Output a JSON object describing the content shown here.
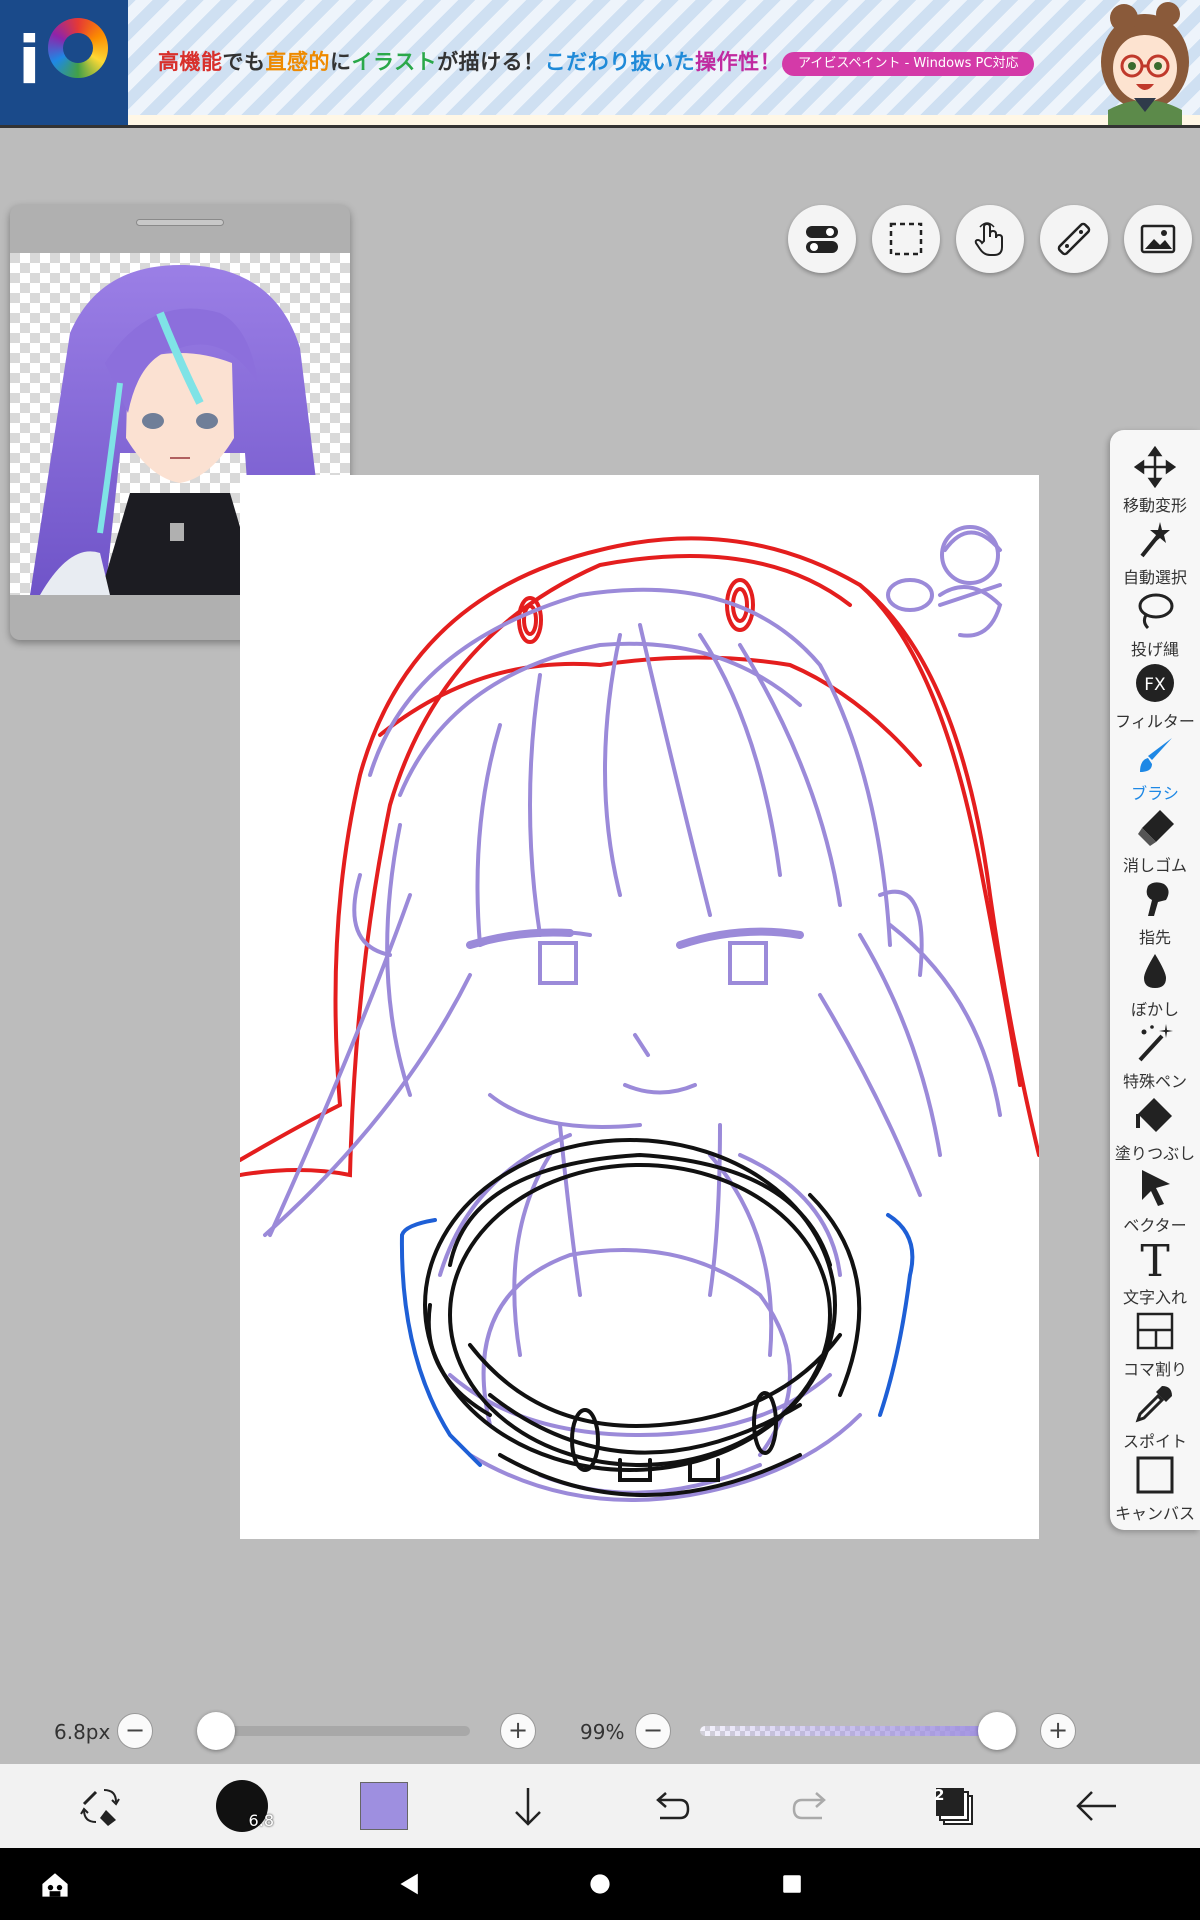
{
  "banner": {
    "headline_segments": [
      {
        "text": "高機能",
        "color": "#d8302c"
      },
      {
        "text": "でも",
        "color": "#333333"
      },
      {
        "text": "直感的",
        "color": "#ee8a00"
      },
      {
        "text": "に",
        "color": "#333333"
      },
      {
        "text": "イラスト",
        "color": "#2aa84a"
      },
      {
        "text": "が描ける！",
        "color": "#333333"
      },
      {
        "text": "こだわり抜いた",
        "color": "#1f8ad8"
      },
      {
        "text": "操作性！",
        "color": "#c02aa0"
      }
    ],
    "badge": "アイビスペイント - Windows PC対応"
  },
  "toolbar": {
    "items": [
      {
        "label": "移動変形",
        "icon": "move-icon"
      },
      {
        "label": "自動選択",
        "icon": "magic-wand-icon"
      },
      {
        "label": "投げ縄",
        "icon": "lasso-icon"
      },
      {
        "label": "フィルター",
        "icon": "fx-icon"
      },
      {
        "label": "ブラシ",
        "icon": "brush-icon",
        "active": true
      },
      {
        "label": "消しゴム",
        "icon": "eraser-icon"
      },
      {
        "label": "指先",
        "icon": "finger-icon"
      },
      {
        "label": "ぼかし",
        "icon": "blur-drop-icon"
      },
      {
        "label": "特殊ペン",
        "icon": "special-pen-icon"
      },
      {
        "label": "塗りつぶし",
        "icon": "fill-bucket-icon"
      },
      {
        "label": "ベクター",
        "icon": "vector-cursor-icon"
      },
      {
        "label": "文字入れ",
        "icon": "text-icon"
      },
      {
        "label": "コマ割り",
        "icon": "frame-divider-icon"
      },
      {
        "label": "スポイト",
        "icon": "eyedropper-icon"
      },
      {
        "label": "キャンバス",
        "icon": "canvas-icon"
      }
    ],
    "accent": "#1e88e5"
  },
  "brush": {
    "size_label": "6.8px",
    "opacity_label": "99%",
    "preview_label": "6.8",
    "size_fraction": 0.06,
    "opacity_fraction": 0.99,
    "color": "#9e8fe0"
  },
  "layers": {
    "count": "2"
  }
}
